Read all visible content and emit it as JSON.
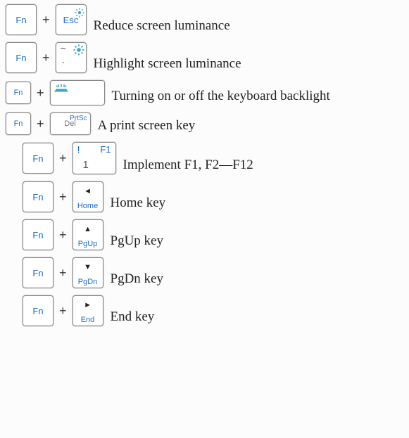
{
  "labels": {
    "fn": "Fn",
    "plus": "+",
    "esc": "Esc",
    "tilde": "~",
    "backtick": "`",
    "del": "Del",
    "prtsc": "PrtSc",
    "excl": "!",
    "f1": "F1",
    "one": "1",
    "home": "Home",
    "pgup": "PgUp",
    "pgdn": "PgDn",
    "end": "End"
  },
  "icons": {
    "brightness_corner": "brightness-icon",
    "brightness_up": "brightness-up-icon",
    "backlight": "keyboard-backlight-icon",
    "arrow_left": "◄",
    "arrow_up": "▲",
    "arrow_down": "▼",
    "arrow_right": "►"
  },
  "rows": [
    {
      "desc": "Reduce screen luminance"
    },
    {
      "desc": "Highlight screen luminance"
    },
    {
      "desc": "Turning on or off the keyboard backlight"
    },
    {
      "desc": "A print screen key"
    },
    {
      "desc": "Implement F1, F2—F12"
    },
    {
      "desc": "Home key"
    },
    {
      "desc": "PgUp key"
    },
    {
      "desc": "PgDn key"
    },
    {
      "desc": "End key"
    }
  ]
}
